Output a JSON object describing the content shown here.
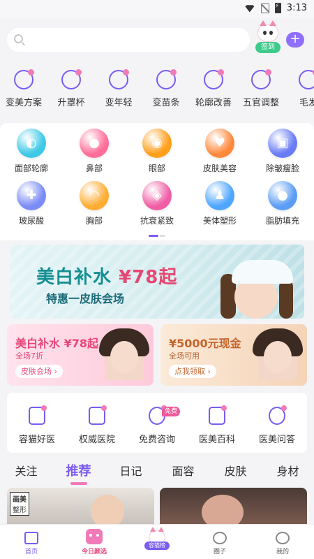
{
  "status_bar": {
    "time": "3:13"
  },
  "header": {
    "checkin_label": "签到",
    "plus_label": "+"
  },
  "top_categories": [
    {
      "label": "变美方案",
      "icon": "plan-icon"
    },
    {
      "label": "升罩杯",
      "icon": "bra-icon"
    },
    {
      "label": "变年轻",
      "icon": "syringe-icon"
    },
    {
      "label": "变苗条",
      "icon": "body-icon"
    },
    {
      "label": "轮廓改善",
      "icon": "face-outline-icon"
    },
    {
      "label": "五官调整",
      "icon": "nose-icon"
    },
    {
      "label": "毛发",
      "icon": "hair-icon"
    }
  ],
  "grid_items": [
    {
      "label": "面部轮廓",
      "color": "#3ec9e6",
      "glyph": "◐"
    },
    {
      "label": "鼻部",
      "color": "#ff6e9a",
      "glyph": "●"
    },
    {
      "label": "眼部",
      "color": "#ff9f1c",
      "glyph": "◉"
    },
    {
      "label": "皮肤美容",
      "color": "#ff8a3d",
      "glyph": "♥"
    },
    {
      "label": "除皱瘦脸",
      "color": "#6a7cf5",
      "glyph": "▣"
    },
    {
      "label": "玻尿酸",
      "color": "#7b8cf7",
      "glyph": "✚"
    },
    {
      "label": "胸部",
      "color": "#ffad33",
      "glyph": "◠"
    },
    {
      "label": "抗衰紧致",
      "color": "#f05fa6",
      "glyph": "◈"
    },
    {
      "label": "美体塑形",
      "color": "#4fa6ff",
      "glyph": "♟"
    },
    {
      "label": "脂肪填充",
      "color": "#5b9df5",
      "glyph": "●"
    }
  ],
  "banner": {
    "title_main": "美白补水",
    "title_price": "¥78起",
    "subtitle": "特惠一皮肤会场"
  },
  "promo_left": {
    "title": "美白补水 ¥78起",
    "sub": "全场7折",
    "button": "皮肤会场 ›"
  },
  "promo_right": {
    "title": "¥5000元现金",
    "sub": "全场可用",
    "button": "点我领取 ›"
  },
  "services": [
    {
      "label": "容猫好医",
      "icon": "doctor-icon"
    },
    {
      "label": "权威医院",
      "icon": "hospital-icon"
    },
    {
      "label": "免费咨询",
      "icon": "robot-icon",
      "badge": "免费"
    },
    {
      "label": "医美百科",
      "icon": "book-icon"
    },
    {
      "label": "医美问答",
      "icon": "question-icon"
    }
  ],
  "tabs": [
    "关注",
    "推荐",
    "日记",
    "面容",
    "皮肤",
    "身材"
  ],
  "active_tab": "推荐",
  "feed": {
    "card1_tag_bold": "画美",
    "card1_tag_rest": "整形"
  },
  "bottom_nav": [
    {
      "label": "首页"
    },
    {
      "label": "今日颜选"
    },
    {
      "label": "容猫榜"
    },
    {
      "label": "圈子"
    },
    {
      "label": "我的"
    }
  ]
}
